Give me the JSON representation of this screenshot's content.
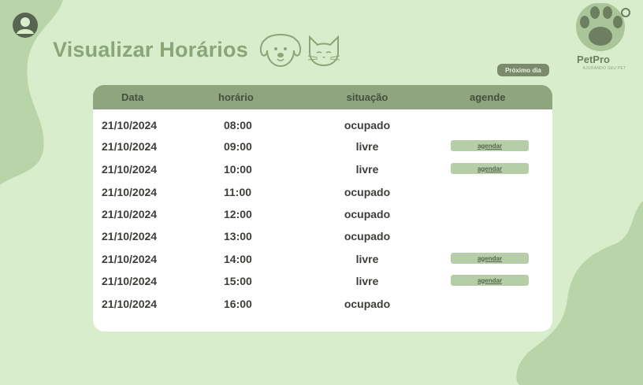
{
  "colors": {
    "background": "#d8edcb",
    "blob": "#b9d4a8",
    "title": "#8aa57a",
    "table_header": "#8ea57f",
    "button": "#b5cea7",
    "next_day_button": "#7a8a6c"
  },
  "header": {
    "avatar_icon": "user-avatar-icon",
    "title": "Visualizar Horários",
    "title_icons": [
      "dog-icon",
      "cat-icon"
    ]
  },
  "logo": {
    "icon": "paw-logo-icon",
    "name": "PetPro",
    "tagline": "AJUDANDO SEU PET"
  },
  "next_day_label": "Próximo dia",
  "table": {
    "columns": [
      "Data",
      "horário",
      "situação",
      "agende"
    ],
    "book_label": "agendar",
    "rows": [
      {
        "date": "21/10/2024",
        "time": "08:00",
        "status": "ocupado",
        "bookable": false
      },
      {
        "date": "21/10/2024",
        "time": "09:00",
        "status": "livre",
        "bookable": true
      },
      {
        "date": "21/10/2024",
        "time": "10:00",
        "status": "livre",
        "bookable": true
      },
      {
        "date": "21/10/2024",
        "time": "11:00",
        "status": "ocupado",
        "bookable": false
      },
      {
        "date": "21/10/2024",
        "time": "12:00",
        "status": "ocupado",
        "bookable": false
      },
      {
        "date": "21/10/2024",
        "time": "13:00",
        "status": "ocupado",
        "bookable": false
      },
      {
        "date": "21/10/2024",
        "time": "14:00",
        "status": "livre",
        "bookable": true
      },
      {
        "date": "21/10/2024",
        "time": "15:00",
        "status": "livre",
        "bookable": true
      },
      {
        "date": "21/10/2024",
        "time": "16:00",
        "status": "ocupado",
        "bookable": false
      }
    ]
  }
}
